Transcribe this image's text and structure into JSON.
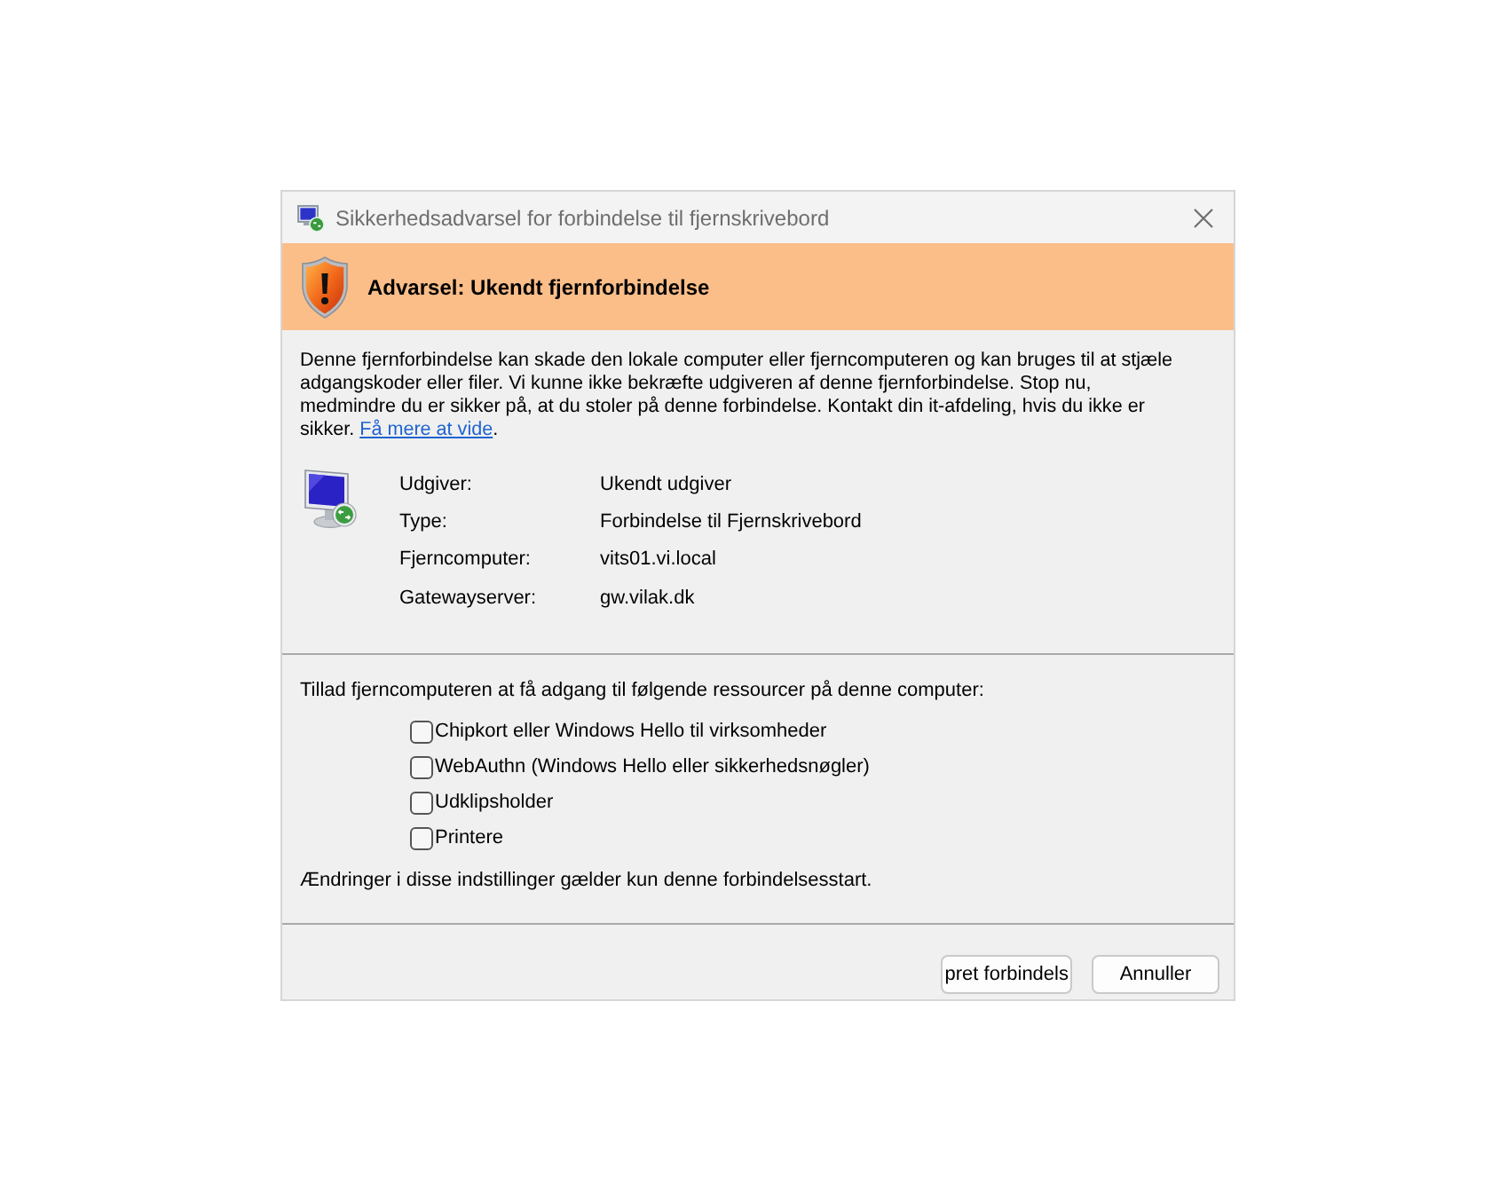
{
  "window": {
    "title": "Sikkerhedsadvarsel for forbindelse til fjernskrivebord"
  },
  "banner": {
    "heading": "Advarsel: Ukendt fjernforbindelse"
  },
  "message": {
    "text": "Denne fjernforbindelse kan skade den lokale computer eller fjerncomputeren og kan bruges til at stjæle adgangskoder eller filer. Vi kunne ikke bekræfte udgiveren af denne fjernforbindelse. Stop nu, medmindre du er sikker på, at du stoler på denne forbindelse. Kontakt din it-afdeling, hvis du ikke er sikker.",
    "link": "Få mere at vide",
    "tail": "."
  },
  "details": [
    {
      "label": "Udgiver:",
      "value": "Ukendt udgiver"
    },
    {
      "label": "Type:",
      "value": "Forbindelse til Fjernskrivebord"
    },
    {
      "label": "Fjerncomputer:",
      "value": "vits01.vi.local"
    },
    {
      "label": "Gatewayserver:",
      "value": "gw.vilak.dk"
    }
  ],
  "resources": {
    "prompt": "Tillad fjerncomputeren at få adgang til følgende ressourcer på denne computer:",
    "options": [
      {
        "label": "Chipkort eller Windows Hello til virksomheder",
        "checked": false
      },
      {
        "label": "WebAuthn (Windows Hello eller sikkerhedsnøgler)",
        "checked": false
      },
      {
        "label": "Udklipsholder",
        "checked": false
      },
      {
        "label": "Printere",
        "checked": false
      }
    ],
    "note": "Ændringer i disse indstillinger gælder kun denne forbindelsesstart."
  },
  "buttons": [
    {
      "label": "pret forbindels"
    },
    {
      "label": "Annuller"
    }
  ]
}
